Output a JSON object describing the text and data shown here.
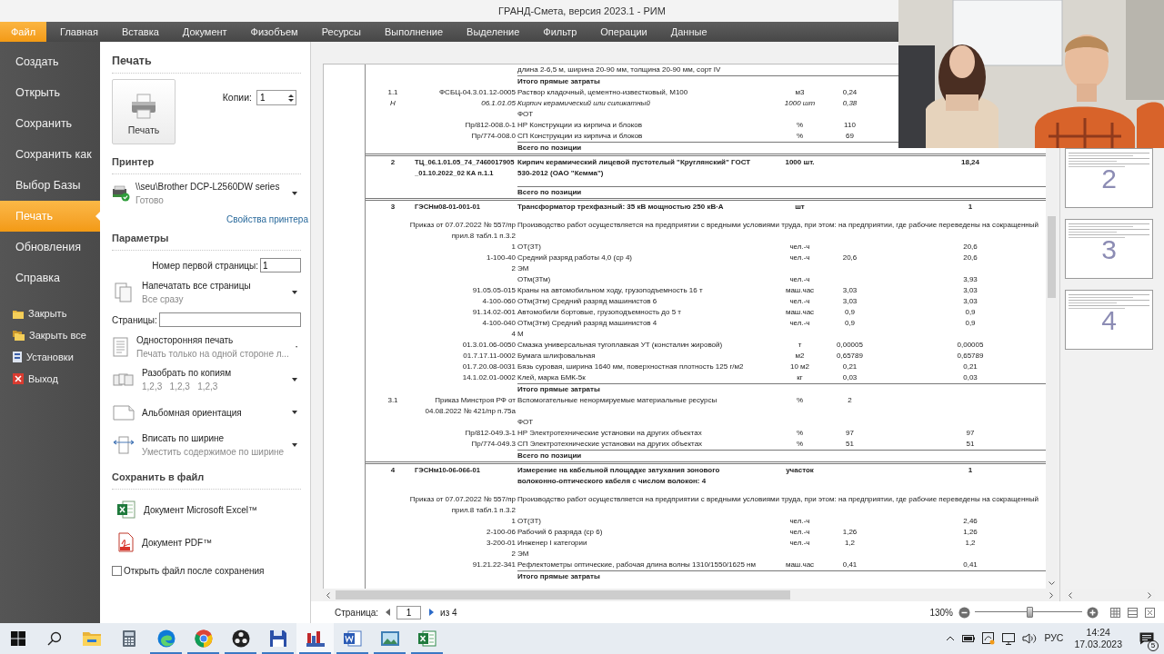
{
  "window": {
    "title": "ГРАНД-Смета, версия 2023.1 - РИМ"
  },
  "menu": [
    {
      "label": "Файл",
      "selected": true
    },
    {
      "label": "Главная",
      "selected": false
    },
    {
      "label": "Вставка",
      "selected": false
    },
    {
      "label": "Документ",
      "selected": false
    },
    {
      "label": "Физобъем",
      "selected": false
    },
    {
      "label": "Ресурсы",
      "selected": false
    },
    {
      "label": "Выполнение",
      "selected": false
    },
    {
      "label": "Выделение",
      "selected": false
    },
    {
      "label": "Фильтр",
      "selected": false
    },
    {
      "label": "Операции",
      "selected": false
    },
    {
      "label": "Данные",
      "selected": false
    }
  ],
  "nav": {
    "items": [
      {
        "label": "Создать",
        "selected": false
      },
      {
        "label": "Открыть",
        "selected": false
      },
      {
        "label": "Сохранить",
        "selected": false
      },
      {
        "label": "Сохранить как",
        "selected": false
      },
      {
        "label": "Выбор Базы",
        "selected": false
      },
      {
        "label": "Печать",
        "selected": true
      },
      {
        "label": "Обновления",
        "selected": false
      },
      {
        "label": "Справка",
        "selected": false
      }
    ],
    "commands": [
      {
        "label": "Закрыть"
      },
      {
        "label": "Закрыть все"
      },
      {
        "label": "Установки"
      },
      {
        "label": "Выход"
      }
    ]
  },
  "print": {
    "heading": "Печать",
    "print_button": "Печать",
    "copies_label": "Копии:",
    "copies": "1",
    "printer_heading": "Принтер",
    "printer": {
      "name": "\\\\seu\\Brother DCP-L2560DW series",
      "status": "Готово"
    },
    "printer_properties": "Свойства принтера",
    "params_heading": "Параметры",
    "params": [
      {
        "kind": "field",
        "label": "Номер первой страницы:",
        "value": "1"
      },
      {
        "kind": "dropdown",
        "title": "Напечатать все страницы",
        "subtitle": "Все сразу"
      },
      {
        "kind": "field",
        "label": "Страницы:"
      },
      {
        "kind": "dropdown",
        "title": "Односторонняя печать",
        "subtitle": "Печать только на одной стороне л..."
      },
      {
        "kind": "dropdown",
        "title": "Разобрать по копиям",
        "subtitle": "1,2,3   1,2,3   1,2,3"
      },
      {
        "kind": "dropdown",
        "title": "Альбомная ориентация"
      },
      {
        "kind": "dropdown",
        "title": "Вписать по ширине",
        "subtitle": "Уместить содержимое по ширине"
      }
    ],
    "save_heading": "Сохранить в файл",
    "save_targets": [
      "Документ Microsoft Excel™",
      "Документ PDF™"
    ],
    "open_after_save": {
      "label": "Открыть файл после сохранения",
      "checked": false
    }
  },
  "document": {
    "rows": [
      {
        "kind": "line",
        "name": "длина 2-6,5 м, ширина 20-90 мм, толщина 20-90 мм, сорт IV"
      },
      {
        "kind": "subtotal",
        "name": "Итого прямые затраты"
      },
      {
        "kind": "line",
        "num": "1.1",
        "code": "ФСБЦ-04.3.01.12-0005",
        "name": "Раствор кладочный, цементно-известковый, М100",
        "unit": "м3",
        "qty": "0,24"
      },
      {
        "kind": "italic_line",
        "num": "Н",
        "code": "06.1.01.05",
        "name": "Кирпич керамический или силикатный",
        "unit": "1000 шт",
        "qty": "0,38"
      },
      {
        "kind": "line",
        "name": "ФОТ"
      },
      {
        "kind": "line",
        "code": "Пр/812-008.0-1",
        "name": "НР Конструкции из кирпича и блоков",
        "unit": "%",
        "qty": "110"
      },
      {
        "kind": "line",
        "code": "Пр/774-008.0",
        "name": "СП Конструкции из кирпича и блоков",
        "unit": "%",
        "qty": "69"
      },
      {
        "kind": "subtotal",
        "name": "Всего по позиции"
      },
      {
        "kind": "position",
        "num": "2",
        "code": "ТЦ_06.1.01.05_74_7460017905_01.10.2022_02 КА п.1.1",
        "name": "Кирпич керамический лицевой пустотелый \"Круглянский\" ГОСТ 530-2012 (ОАО \"Кемма\")",
        "unit": "1000 шт.",
        "total": "18,24"
      },
      {
        "kind": "subtotal",
        "name": "Всего по позиции"
      },
      {
        "kind": "position",
        "num": "3",
        "code": "ГЭСНм08-01-001-01",
        "name": "Трансформатор трехфазный: 35 кВ мощностью 250 кВ·А",
        "unit": "шт",
        "total": "1"
      },
      {
        "kind": "note",
        "code": "Приказ от 07.07.2022 № 557/пр прил.8 табл.1 п.3.2",
        "name": "Производство работ осуществляется на предприятии с вредными условиями труда, при этом: на предприятии, где рабочие переведены на сокращенный"
      },
      {
        "kind": "line",
        "code": "1",
        "name": "ОТ(ЗТ)",
        "unit": "чел.-ч",
        "total": "20,6"
      },
      {
        "kind": "line",
        "code": "1-100-40",
        "name": "Средний разряд работы 4,0 (ср 4)",
        "unit": "чел.-ч",
        "qty": "20,6",
        "total": "20,6"
      },
      {
        "kind": "line",
        "code": "2",
        "name": "ЭМ"
      },
      {
        "kind": "line",
        "name": "ОТм(ЗТм)",
        "unit": "чел.-ч",
        "total": "3,93"
      },
      {
        "kind": "line",
        "code": "91.05.05-015",
        "name": "Краны на автомобильном ходу, грузоподъемность 16 т",
        "unit": "маш.час",
        "qty": "3,03",
        "total": "3,03"
      },
      {
        "kind": "line",
        "code": "4-100-060",
        "name": "ОТм(Зтм) Средний разряд машинистов 6",
        "unit": "чел.-ч",
        "qty": "3,03",
        "total": "3,03"
      },
      {
        "kind": "line",
        "code": "91.14.02-001",
        "name": "Автомобили бортовые, грузоподъемность до 5 т",
        "unit": "маш.час",
        "qty": "0,9",
        "total": "0,9"
      },
      {
        "kind": "line",
        "code": "4-100-040",
        "name": "ОТм(Зтм) Средний разряд машинистов 4",
        "unit": "чел.-ч",
        "qty": "0,9",
        "total": "0,9"
      },
      {
        "kind": "line",
        "code": "4",
        "name": "М"
      },
      {
        "kind": "line",
        "code": "01.3.01.06-0050",
        "name": "Смазка универсальная тугоплавкая УТ (консталин жировой)",
        "unit": "т",
        "qty": "0,00005",
        "total": "0,00005"
      },
      {
        "kind": "line",
        "code": "01.7.17.11-0002",
        "name": "Бумага шлифовальная",
        "unit": "м2",
        "qty": "0,65789",
        "total": "0,65789"
      },
      {
        "kind": "line",
        "code": "01.7.20.08-0031",
        "name": "Бязь суровая, ширина 1640 мм, поверхностная плотность 125 г/м2",
        "unit": "10 м2",
        "qty": "0,21",
        "total": "0,21"
      },
      {
        "kind": "line",
        "code": "14.1.02.01-0002",
        "name": "Клей, марка БМК-5к",
        "unit": "кг",
        "qty": "0,03",
        "total": "0,03"
      },
      {
        "kind": "subtotal",
        "name": "Итого прямые затраты"
      },
      {
        "kind": "line",
        "num": "3.1",
        "code": "Приказ Минстроя РФ от 04.08.2022 № 421/пр п.75а",
        "name": "Вспомогательные ненормируемые материальные ресурсы",
        "unit": "%",
        "qty": "2"
      },
      {
        "kind": "line",
        "name": "ФОТ"
      },
      {
        "kind": "line",
        "code": "Пр/812-049.3-1",
        "name": "НР Электротехнические установки на других объектах",
        "unit": "%",
        "qty": "97",
        "total": "97"
      },
      {
        "kind": "line",
        "code": "Пр/774-049.3",
        "name": "СП Электротехнические установки на других объектах",
        "unit": "%",
        "qty": "51",
        "total": "51"
      },
      {
        "kind": "subtotal",
        "name": "Всего по позиции"
      },
      {
        "kind": "position",
        "num": "4",
        "code": "ГЭСНм10-06-066-01",
        "name": "Измерение на кабельной площадке затухания зонового волоконно-оптического кабеля с числом волокон: 4",
        "unit": "участок",
        "total": "1"
      },
      {
        "kind": "note",
        "code": "Приказ от 07.07.2022 № 557/пр прил.8 табл.1 п.3.2",
        "name": "Производство работ осуществляется на предприятии с вредными условиями труда, при этом: на предприятии, где рабочие переведены на сокращенный"
      },
      {
        "kind": "line",
        "code": "1",
        "name": "ОТ(ЗТ)",
        "unit": "чел.-ч",
        "total": "2,46"
      },
      {
        "kind": "line",
        "code": "2-100-06",
        "name": "Рабочий 6 разряда (ср 6)",
        "unit": "чел.-ч",
        "qty": "1,26",
        "total": "1,26"
      },
      {
        "kind": "line",
        "code": "3-200-01",
        "name": "Инженер I категории",
        "unit": "чел.-ч",
        "qty": "1,2",
        "total": "1,2"
      },
      {
        "kind": "line",
        "code": "2",
        "name": "ЭМ"
      },
      {
        "kind": "line",
        "code": "91.21.22-341",
        "name": "Рефлектометры оптические, рабочая длина волны 1310/1550/1625 нм",
        "unit": "маш.час",
        "qty": "0,41",
        "total": "0,41"
      },
      {
        "kind": "subtotal",
        "name": "Итого прямые затраты"
      }
    ]
  },
  "thumbnails": [
    "2",
    "3",
    "4"
  ],
  "status_bar": {
    "page_label": "Страница:",
    "page": "1",
    "page_total": "из 4",
    "zoom": "130%",
    "zoom_slider": {
      "level": 0.51
    }
  },
  "taskbar": {
    "apps": [
      {
        "running": false,
        "selected": false
      },
      {
        "running": false,
        "selected": false
      },
      {
        "running": true,
        "selected": false
      },
      {
        "running": true,
        "selected": false
      },
      {
        "running": true,
        "selected": false
      },
      {
        "running": true,
        "selected": false
      },
      {
        "running": true,
        "selected": true
      },
      {
        "running": true,
        "selected": false
      },
      {
        "running": true,
        "selected": false
      },
      {
        "running": true,
        "selected": false
      }
    ],
    "language": "РУС",
    "time": "14:24",
    "date": "17.03.2023",
    "notifications": "5"
  },
  "webcam": {
    "kind": "picture"
  }
}
